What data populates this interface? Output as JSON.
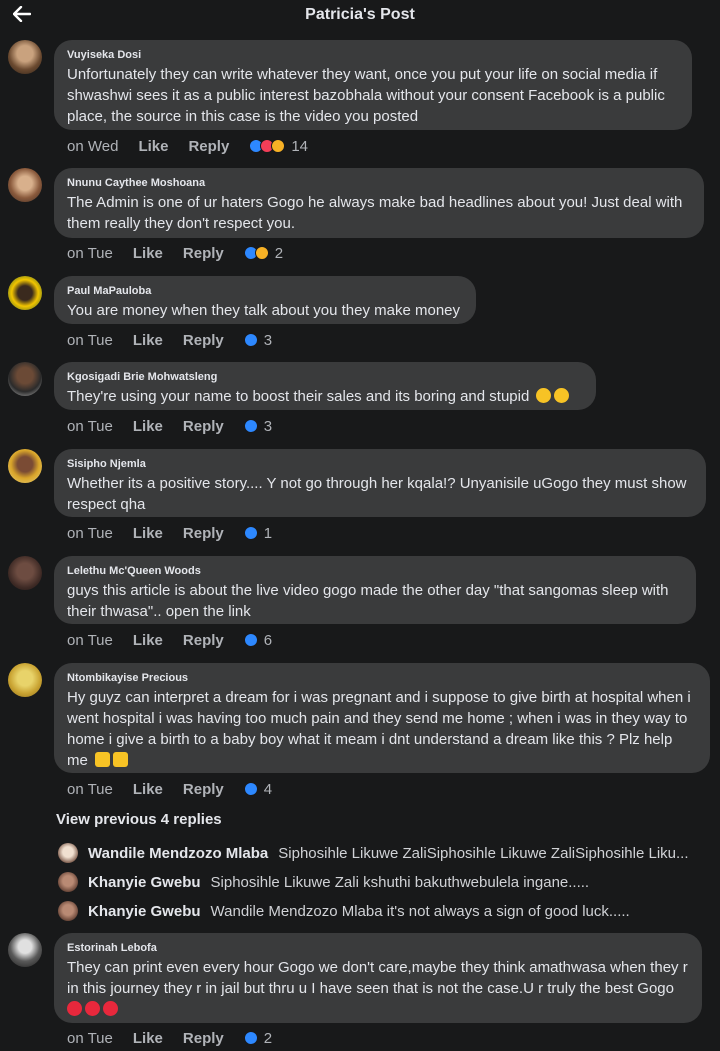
{
  "header": {
    "title": "Patricia's Post"
  },
  "colors": {
    "background": "#18191a",
    "bubble": "#3a3b3c",
    "like_blue": "#2d88ff",
    "love_red": "#f33e58",
    "emoji_yellow": "#f7b125"
  },
  "actions": {
    "like": "Like",
    "reply": "Reply"
  },
  "comments": [
    {
      "author": "Vuyiseka Dosi",
      "text": "Unfortunately they can write whatever they want, once you put your life on social media if shwashwi sees it as a public interest bazobhala without your consent Facebook is a public place, the source in this case is the video you posted",
      "time": "on Wed",
      "reactions": [
        "like",
        "love",
        "haha"
      ],
      "count": "14"
    },
    {
      "author": "Nnunu Caythee Moshoana",
      "text": "The Admin is one of ur haters Gogo he always make bad headlines about you! Just deal with them really they don't respect you.",
      "time": "on Tue",
      "reactions": [
        "like",
        "haha"
      ],
      "count": "2"
    },
    {
      "author": "Paul MaPauloba",
      "text": "You are money when they talk about you they make money",
      "time": "on Tue",
      "reactions": [
        "like"
      ],
      "count": "3"
    },
    {
      "author": "Kgosigadi Brie Mohwatsleng",
      "text": "They're using your name to boost their sales and its boring and stupid",
      "text_emojis": [
        "rolling-eyes",
        "rolling-eyes"
      ],
      "time": "on Tue",
      "reactions": [
        "like"
      ],
      "count": "3"
    },
    {
      "author": "Sisipho Njemla",
      "text": "Whether its a positive story.... Y not go through her kqala!? Unyanisile uGogo they must show respect qha",
      "time": "on Tue",
      "reactions": [
        "like"
      ],
      "count": "1"
    },
    {
      "author": "Lelethu Mc'Queen Woods",
      "text": "guys this article is about the live video gogo made the other day \"that sangomas sleep with their thwasa\".. open the link",
      "time": "on Tue",
      "reactions": [
        "like"
      ],
      "count": "6"
    },
    {
      "author": "Ntombikayise Precious",
      "text": "Hy guyz can  interpret   a dream for i was pregnant  and i suppose  to give birth at hospital when i went hospital  i was having  too much pain  and they send  me home ; when i was in they way to home i give a birth  to a baby boy what it meam i dnt understand a dream like this ? Plz help  me",
      "text_emojis": [
        "folded-hands",
        "folded-hands"
      ],
      "time": "on Tue",
      "reactions": [
        "like"
      ],
      "count": "4"
    },
    {
      "author": "Estorinah Lebofa",
      "text": "They can print even every hour Gogo we don't care,maybe they think amathwasa when they r in this journey they r in jail but thru u I have seen that is not the case.U r truly the best Gogo",
      "text_emojis": [
        "red-heart",
        "red-heart",
        "red-heart"
      ],
      "time": "on Tue",
      "reactions": [
        "like"
      ],
      "count": "2"
    }
  ],
  "replies": {
    "view_previous": "View previous 4 replies",
    "items": [
      {
        "name": "Wandile Mendzozo Mlaba",
        "text": "Siphosihle Likuwe ZaliSiphosihle Likuwe ZaliSiphosihle Liku..."
      },
      {
        "name": "Khanyie Gwebu",
        "text": "Siphosihle Likuwe Zali kshuthi bakuthwebulela ingane....."
      },
      {
        "name": "Khanyie Gwebu",
        "text": "Wandile Mendzozo Mlaba it's not always a sign of good luck....."
      }
    ]
  }
}
